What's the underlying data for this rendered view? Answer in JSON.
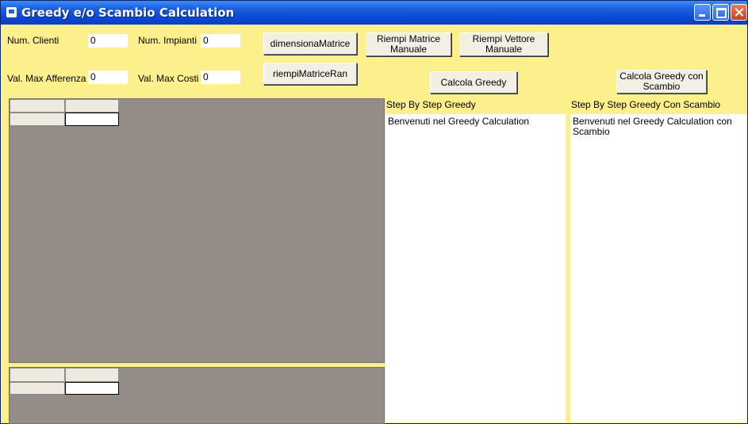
{
  "window": {
    "title": "Greedy e/o Scambio Calculation"
  },
  "inputs": {
    "num_clienti": {
      "label": "Num. Clienti",
      "value": "0"
    },
    "num_impianti": {
      "label": "Num. Impianti",
      "value": "0"
    },
    "val_max_afferenza": {
      "label": "Val. Max Afferenza",
      "value": "0"
    },
    "val_max_costi": {
      "label": "Val. Max Costi",
      "value": "0"
    }
  },
  "buttons": {
    "dimensiona": "dimensionaMatrice",
    "riempi_random": "riempiMatriceRan",
    "riempi_matrice_manuale": "Riempi Matrice\nManuale",
    "riempi_vettore_manuale": "Riempi Vettore\nManuale",
    "calcola_greedy": "Calcola Greedy",
    "calcola_greedy_scambio": "Calcola Greedy con\nScambio"
  },
  "panels": {
    "greedy": {
      "label": "Step By Step Greedy",
      "text": "Benvenuti nel Greedy Calculation"
    },
    "scambio": {
      "label": "Step By Step Greedy Con Scambio",
      "text": "Benvenuti nel Greedy Calculation con\nScambio"
    }
  },
  "colors": {
    "form_bg": "#fbf08c",
    "grid_bg": "#948c86",
    "titlebar": "#0b48d6"
  },
  "icons": [
    "app-icon",
    "minimize-icon",
    "maximize-icon",
    "close-icon"
  ]
}
